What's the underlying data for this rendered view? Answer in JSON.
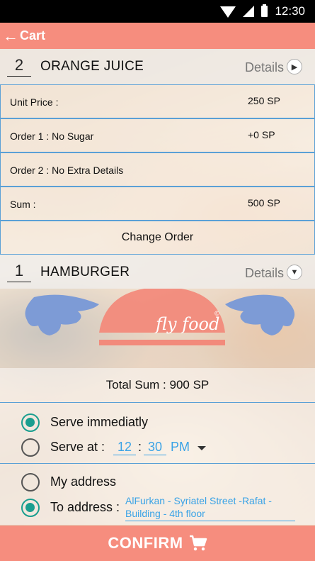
{
  "status_bar": {
    "time": "12:30"
  },
  "app_bar": {
    "back_icon": "arrow-left-icon",
    "title": "Cart"
  },
  "items": [
    {
      "quantity": "2",
      "name": "ORANGE JUICE",
      "details_label": "Details",
      "details_icon": "chevron-right-circle-icon",
      "rows": [
        {
          "label": "Unit Price :",
          "value": "250 SP"
        },
        {
          "label": "Order 1 : No Sugar",
          "value": "+0 SP"
        },
        {
          "label": "Order 2 : No Extra Details",
          "value": ""
        },
        {
          "label": "Sum :",
          "value": "500 SP"
        }
      ],
      "change_order_label": "Change Order"
    },
    {
      "quantity": "1",
      "name": "HAMBURGER",
      "details_label": "Details",
      "details_icon": "chevron-down-circle-icon"
    }
  ],
  "logo": {
    "text": "fly food",
    "mark": "©"
  },
  "total": {
    "label": "Total Sum : 900 SP"
  },
  "serve": {
    "immediately_label": "Serve immediatly",
    "at_label": "Serve at :",
    "hour": "12",
    "minute": "30",
    "ampm": "PM",
    "selected": "immediately"
  },
  "address": {
    "my_address_label": "My address",
    "to_address_label": "To address :",
    "to_address_value": "AlFurkan - Syriatel Street -Rafat - Building - 4th floor",
    "selected": "to_address"
  },
  "confirm": {
    "label": "CONFIRM",
    "icon": "cart-icon"
  },
  "colors": {
    "accent": "#f68d7e",
    "radio": "#1a9e8f",
    "link": "#3aa3e6",
    "divider": "#5aa0d6"
  }
}
